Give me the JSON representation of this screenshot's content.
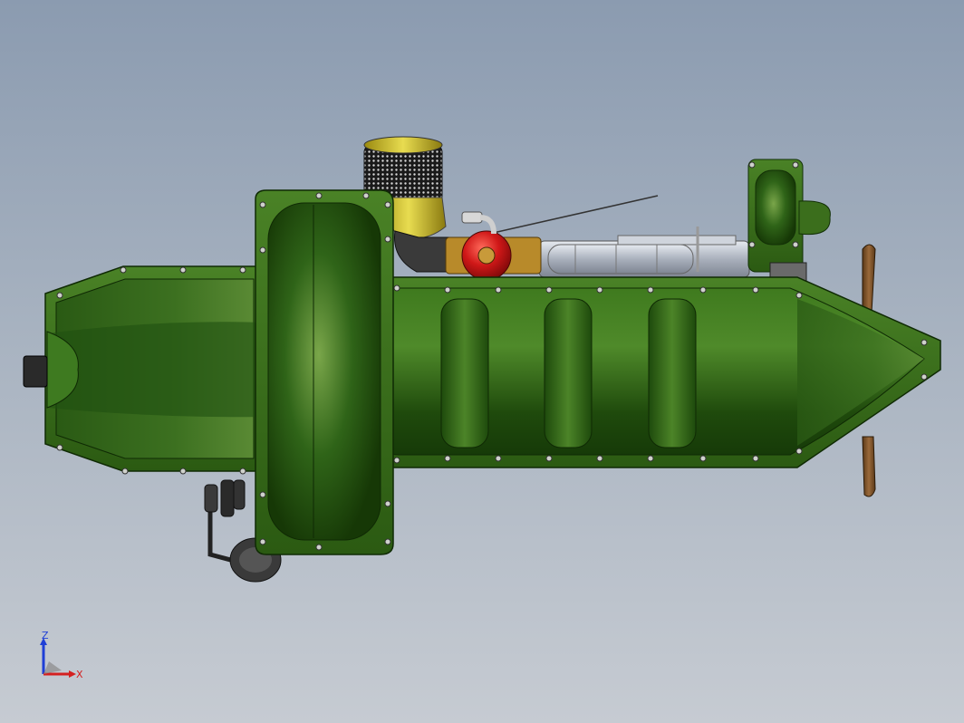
{
  "triad": {
    "z_label": "Z",
    "x_label": "X",
    "z_color": "#1f3fd6",
    "x_color": "#d42020"
  },
  "colors": {
    "body_green": "#2f6418",
    "body_light": "#6a9a3a",
    "body_dark": "#1a3e0a",
    "flange": "#3a7020",
    "bolt": "#c9ccc4",
    "filter_yellow": "#d6c830",
    "carb_red": "#d01818",
    "brass": "#b88a2a",
    "manifold_silver": "#b8bec8",
    "propeller_wood": "#7a5028"
  }
}
